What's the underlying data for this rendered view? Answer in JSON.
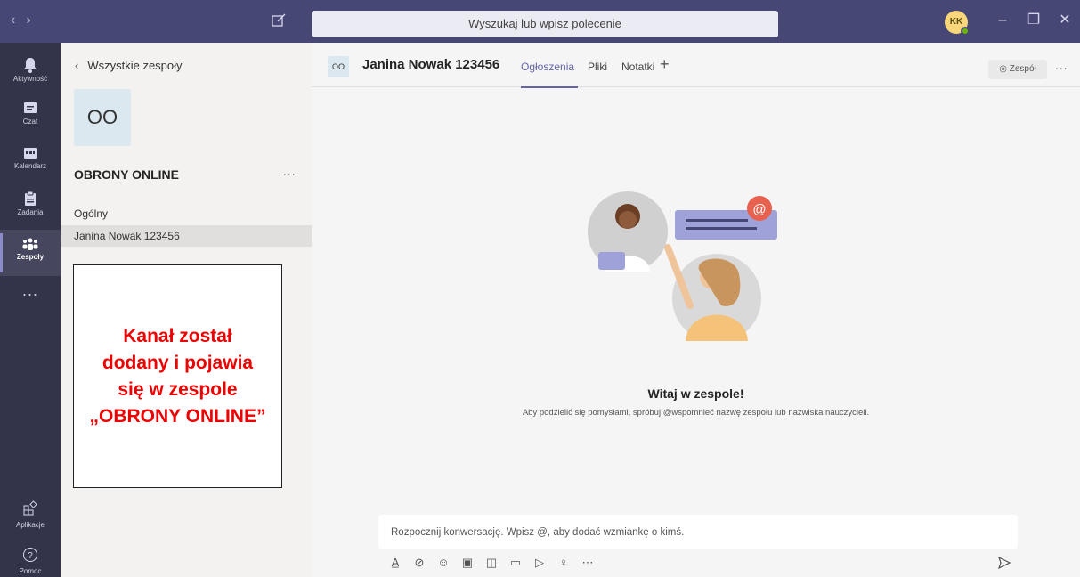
{
  "titlebar": {
    "search_placeholder": "Wyszukaj lub wpisz polecenie",
    "avatar_initials": "KK",
    "presence_color": "#6bb700",
    "bar_color": "#464775"
  },
  "rail": {
    "items": [
      {
        "label": "Aktywność",
        "icon": "bell-icon"
      },
      {
        "label": "Czat",
        "icon": "chat-icon"
      },
      {
        "label": "Kalendarz",
        "icon": "calendar-icon"
      },
      {
        "label": "Zadania",
        "icon": "assignments-icon"
      },
      {
        "label": "Zespoły",
        "icon": "teams-icon"
      }
    ],
    "more": "...",
    "apps_label": "Aplikacje",
    "help_label": "Pomoc",
    "active": "Zespoły"
  },
  "team_panel": {
    "back_label": "Wszystkie zespoły",
    "team_initials": "OO",
    "team_name": "OBRONY ONLINE",
    "more": "...",
    "channels": [
      "Ogólny",
      "Janina Nowak 123456"
    ],
    "selected_channel": "Janina Nowak 123456"
  },
  "annotation": {
    "text": "Kanał został dodany i pojawia się w zespole „OBRONY ONLINE”",
    "color": "#ee0000"
  },
  "main": {
    "channel_initials": "OO",
    "channel_title": "Janina Nowak 123456",
    "tabs": [
      "Ogłoszenia",
      "Pliki",
      "Notatki"
    ],
    "active_tab": "Ogłoszenia",
    "add_tab": "+",
    "team_button": "Zespół",
    "more": "...",
    "welcome_title": "Witaj w zespole!",
    "welcome_subtitle": "Aby podzielić się pomysłami, spróbuj @wspomnieć nazwę zespołu lub nazwiska nauczycieli.",
    "composer_placeholder": "Rozpocznij konwersację. Wpisz @, aby dodać wzmiankę o kimś.",
    "accent_color": "#6264a7"
  },
  "composer_tools": [
    "format-icon",
    "attach-icon",
    "emoji-icon",
    "gif-icon",
    "sticker-icon",
    "meet-icon",
    "stream-icon",
    "praise-icon",
    "more-icon",
    "send-icon"
  ]
}
